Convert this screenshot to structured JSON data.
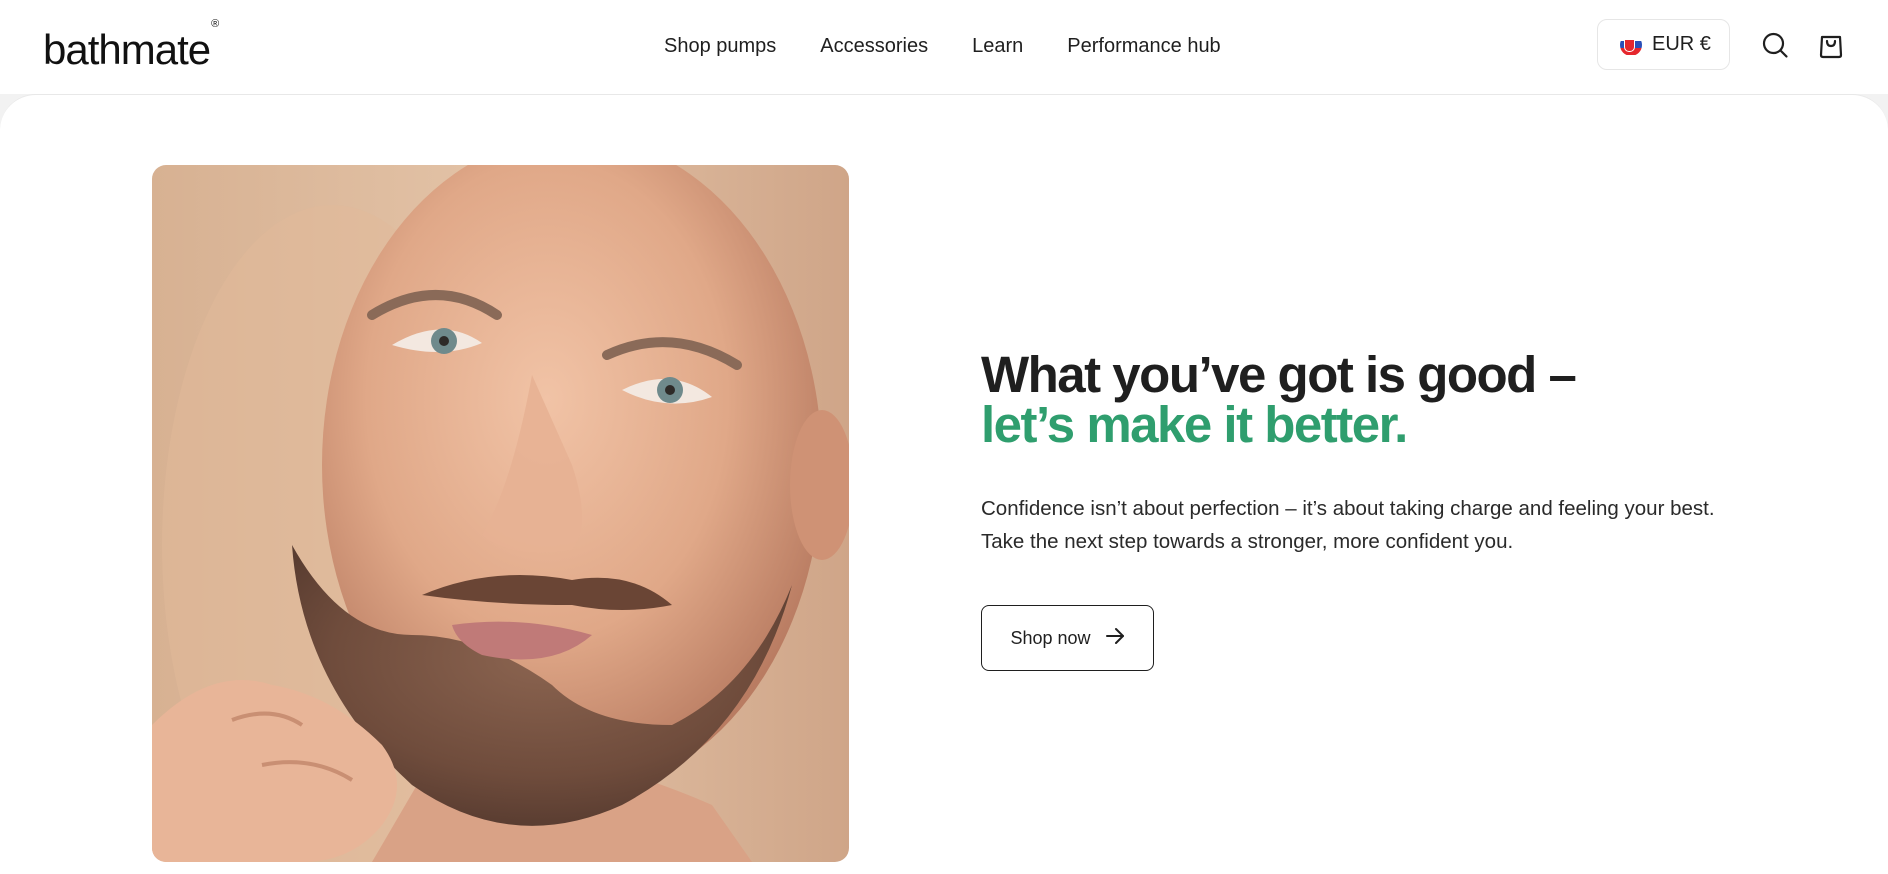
{
  "header": {
    "logo_text": "bathmate",
    "logo_mark": "®",
    "nav": [
      {
        "label": "Shop pumps"
      },
      {
        "label": "Accessories"
      },
      {
        "label": "Learn"
      },
      {
        "label": "Performance hub"
      }
    ],
    "currency": {
      "label": "EUR €",
      "flag_icon": "slovakia-flag-icon"
    },
    "icons": {
      "search": "search-icon",
      "cart": "shopping-bag-icon"
    }
  },
  "hero": {
    "headline_line1": "What you’ve got is good –",
    "headline_line2": "let’s make it better.",
    "body_line1": "Confidence isn’t about perfection – it’s about taking charge and feeling your best.",
    "body_line2": "Take the next step towards a stronger, more confident you.",
    "cta_label": "Shop now",
    "cta_icon": "arrow-right-icon"
  },
  "colors": {
    "accent_green": "#2f9e6e",
    "text_dark": "#1f1f1f",
    "background": "#ffffff"
  }
}
